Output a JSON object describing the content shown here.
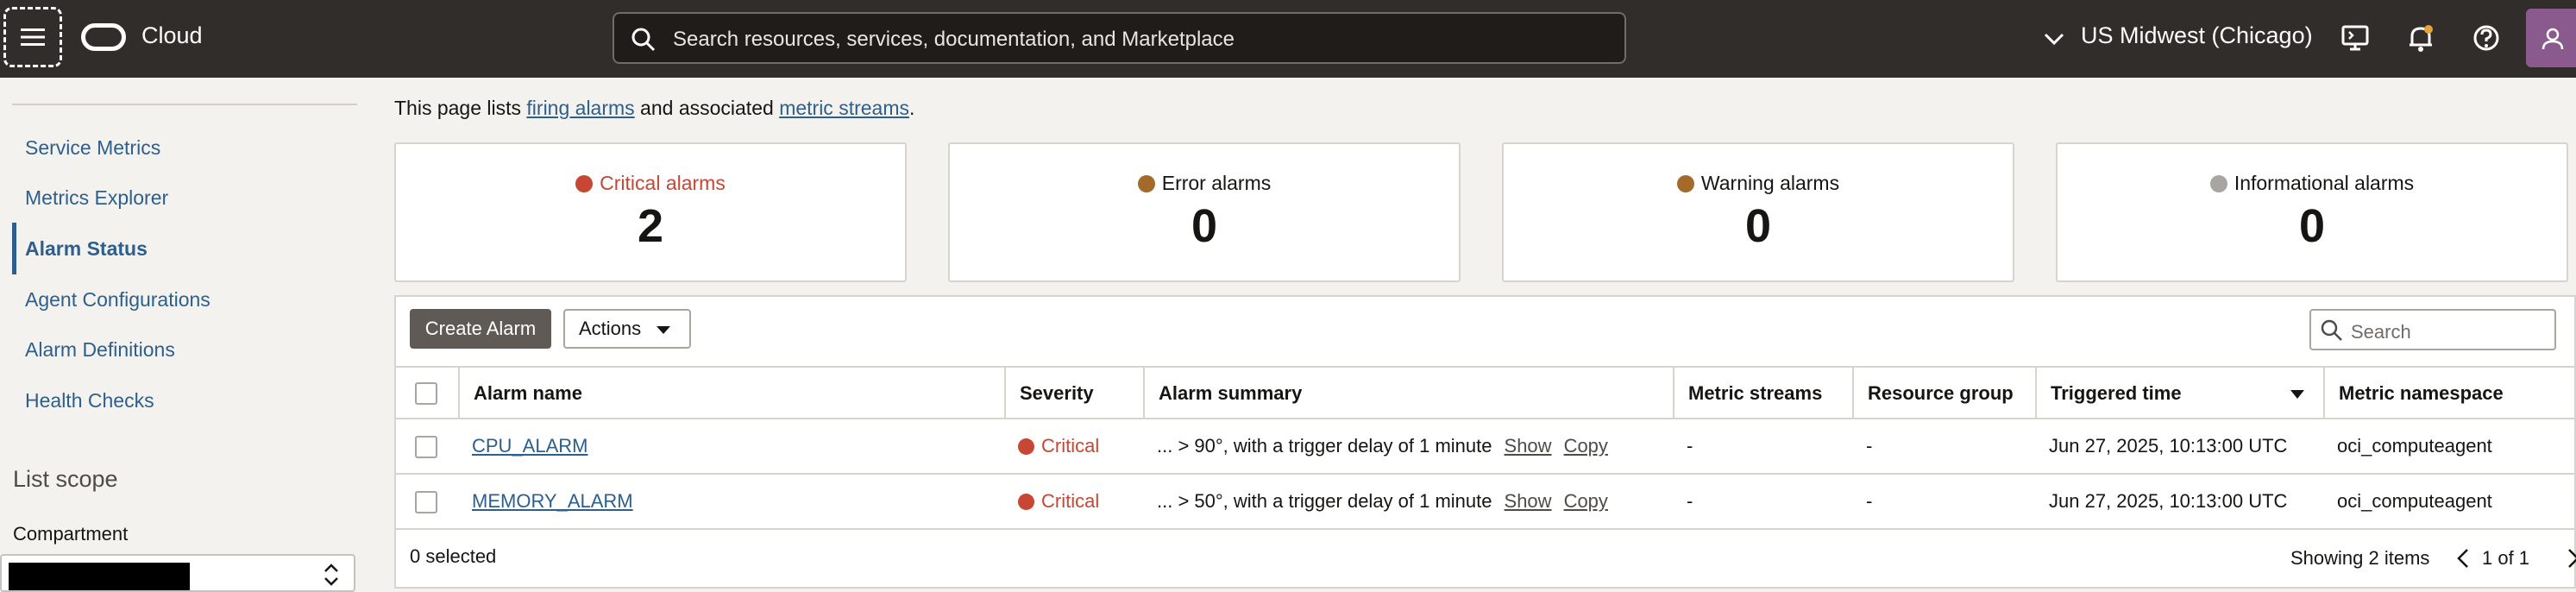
{
  "header": {
    "brand": "Cloud",
    "search_placeholder": "Search resources, services, documentation, and Marketplace",
    "region": "US Midwest (Chicago)"
  },
  "sidebar": {
    "items": [
      {
        "label": "Service Metrics"
      },
      {
        "label": "Metrics Explorer"
      },
      {
        "label": "Alarm Status"
      },
      {
        "label": "Agent Configurations"
      },
      {
        "label": "Alarm Definitions"
      },
      {
        "label": "Health Checks"
      }
    ],
    "scope_title": "List scope",
    "compartment_label": "Compartment"
  },
  "intro": {
    "prefix": "This page lists ",
    "link1": "firing alarms",
    "middle": " and associated ",
    "link2": "metric streams",
    "suffix": "."
  },
  "cards": [
    {
      "label": "Critical alarms",
      "count": "2",
      "color": "#c74634"
    },
    {
      "label": "Error alarms",
      "count": "0",
      "color": "#a36a2a"
    },
    {
      "label": "Warning alarms",
      "count": "0",
      "color": "#a36a2a"
    },
    {
      "label": "Informational alarms",
      "count": "0",
      "color": "#a9a5a1"
    }
  ],
  "toolbar": {
    "create_label": "Create Alarm",
    "actions_label": "Actions",
    "search_placeholder": "Search"
  },
  "table": {
    "columns": [
      "Alarm name",
      "Severity",
      "Alarm summary",
      "Metric streams",
      "Resource group",
      "Triggered time",
      "Metric namespace"
    ],
    "rows": [
      {
        "name": "CPU_ALARM",
        "severity": "Critical",
        "summary": "... > 90°, with a trigger delay of 1 minute",
        "show": "Show",
        "copy": "Copy",
        "streams": "-",
        "group": "-",
        "time": "Jun 27, 2025, 10:13:00 UTC",
        "namespace": "oci_computeagent"
      },
      {
        "name": "MEMORY_ALARM",
        "severity": "Critical",
        "summary": "... > 50°, with a trigger delay of 1 minute",
        "show": "Show",
        "copy": "Copy",
        "streams": "-",
        "group": "-",
        "time": "Jun 27, 2025, 10:13:00 UTC",
        "namespace": "oci_computeagent"
      }
    ],
    "selected": "0 selected",
    "showing": "Showing 2 items",
    "pages": "1 of 1"
  }
}
